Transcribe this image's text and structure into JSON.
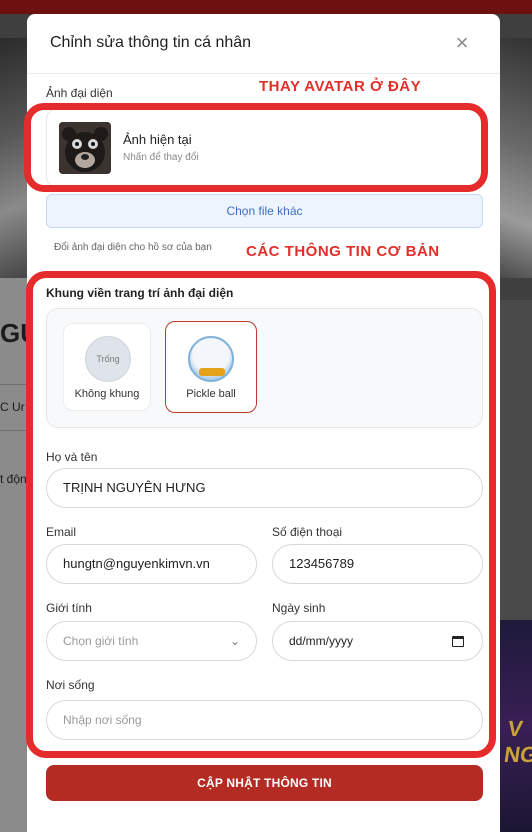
{
  "background": {
    "left_texts": [
      "GUY",
      "C Ur",
      "t độn"
    ],
    "right_art_text": "V\nNG"
  },
  "modal": {
    "title": "Chỉnh sửa thông tin cá nhân",
    "close_icon": "close-icon"
  },
  "avatar_section": {
    "label": "Ảnh đại diện",
    "current_title": "Ảnh hiện tại",
    "current_sub": "Nhấn để thay đổi",
    "choose_file_label": "Chọn file khác",
    "help_text": "Đổi ảnh đại diện cho hồ sơ của bạn"
  },
  "frame_section": {
    "label": "Khung viền trang trí ảnh đại diện",
    "options": [
      {
        "label": "Không khung",
        "circle_text": "Trống",
        "selected": false
      },
      {
        "label": "Pickle ball",
        "circle_text": "",
        "selected": true
      }
    ]
  },
  "form": {
    "fullname_label": "Họ và tên",
    "fullname_value": "TRỊNH NGUYÊN HƯNG",
    "email_label": "Email",
    "email_value": "hungtn@nguyenkimvn.vn",
    "phone_label": "Số điện thoại",
    "phone_value": "123456789",
    "gender_label": "Giới tính",
    "gender_placeholder": "Chọn giới tính",
    "dob_label": "Ngày sinh",
    "dob_placeholder": "dd/mm/yyyy",
    "address_label": "Nơi sống",
    "address_placeholder": "Nhập nơi sống",
    "submit_label": "CẬP NHẬT THÔNG TIN"
  },
  "annotations": {
    "avatar_note": "THAY AVATAR Ở ĐÂY",
    "basic_info_note": "CÁC THÔNG TIN CƠ BẢN"
  },
  "colors": {
    "brand_red": "#b32b22",
    "annotation_red": "#e52b2b",
    "link_blue": "#3b6fc4"
  }
}
